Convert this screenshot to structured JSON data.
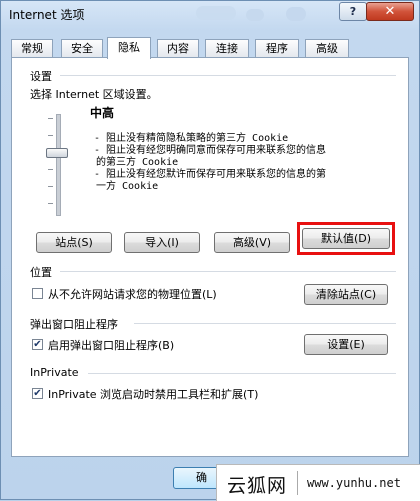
{
  "window": {
    "title": "Internet 选项",
    "help_label": "?",
    "close_label": "✕"
  },
  "tabs": [
    {
      "label": "常规"
    },
    {
      "label": "安全"
    },
    {
      "label": "隐私"
    },
    {
      "label": "内容"
    },
    {
      "label": "连接"
    },
    {
      "label": "程序"
    },
    {
      "label": "高级"
    }
  ],
  "settings": {
    "group_label": "设置",
    "instruction": "选择 Internet 区域设置。",
    "level": "中高",
    "description_lines": [
      "- 阻止没有精简隐私策略的第三方 Cookie",
      "- 阻止没有经您明确同意而保存可用来联系您的信息",
      "的第三方 Cookie",
      "- 阻止没有经您默许而保存可用来联系您的信息的第",
      "一方 Cookie"
    ],
    "buttons": {
      "sites": "站点(S)",
      "import": "导入(I)",
      "advanced": "高级(V)",
      "default": "默认值(D)"
    }
  },
  "location": {
    "group_label": "位置",
    "checkbox_label": "从不允许网站请求您的物理位置(L)",
    "checkbox_checked": false,
    "clear_button": "清除站点(C)"
  },
  "popup": {
    "group_label": "弹出窗口阻止程序",
    "checkbox_label": "启用弹出窗口阻止程序(B)",
    "checkbox_checked": true,
    "settings_button": "设置(E)"
  },
  "inprivate": {
    "group_label": "InPrivate",
    "checkbox_label": "InPrivate 浏览启动时禁用工具栏和扩展(T)",
    "checkbox_checked": true
  },
  "footer": {
    "ok_button_partial": "确"
  },
  "watermark": {
    "logo": "云狐网",
    "url": "www.yunhu.net"
  },
  "icons": [
    "help-icon",
    "close-icon",
    "checkmark-icon"
  ],
  "colors": {
    "highlight": "#e81010",
    "panel": "#ffffff"
  }
}
